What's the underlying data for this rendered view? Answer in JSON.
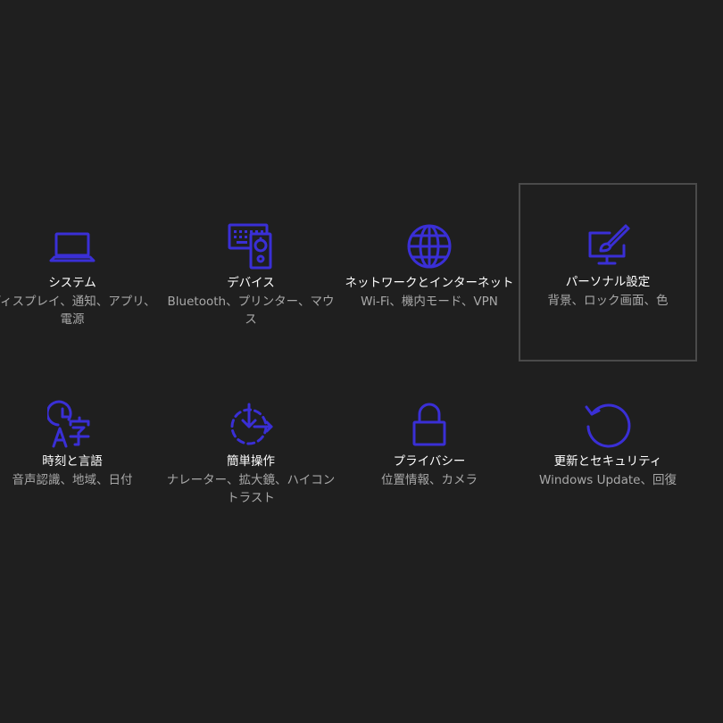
{
  "accent_color": "#3a2fd6",
  "background_color": "#1f1f1f",
  "tiles": [
    {
      "title": "システム",
      "desc": "ディスプレイ、通知、アプリ、電源",
      "icon": "laptop-icon"
    },
    {
      "title": "デバイス",
      "desc": "Bluetooth、プリンター、マウス",
      "icon": "devices-icon"
    },
    {
      "title": "ネットワークとインターネット",
      "desc": "Wi-Fi、機内モード、VPN",
      "icon": "globe-icon"
    },
    {
      "title": "パーソナル設定",
      "desc": "背景、ロック画面、色",
      "icon": "personalization-icon"
    },
    {
      "title": "時刻と言語",
      "desc": "音声認識、地域、日付",
      "icon": "time-language-icon"
    },
    {
      "title": "簡単操作",
      "desc": "ナレーター、拡大鏡、ハイコントラスト",
      "icon": "ease-of-access-icon"
    },
    {
      "title": "プライバシー",
      "desc": "位置情報、カメラ",
      "icon": "lock-icon"
    },
    {
      "title": "更新とセキュリティ",
      "desc": "Windows Update、回復",
      "icon": "update-icon"
    }
  ]
}
